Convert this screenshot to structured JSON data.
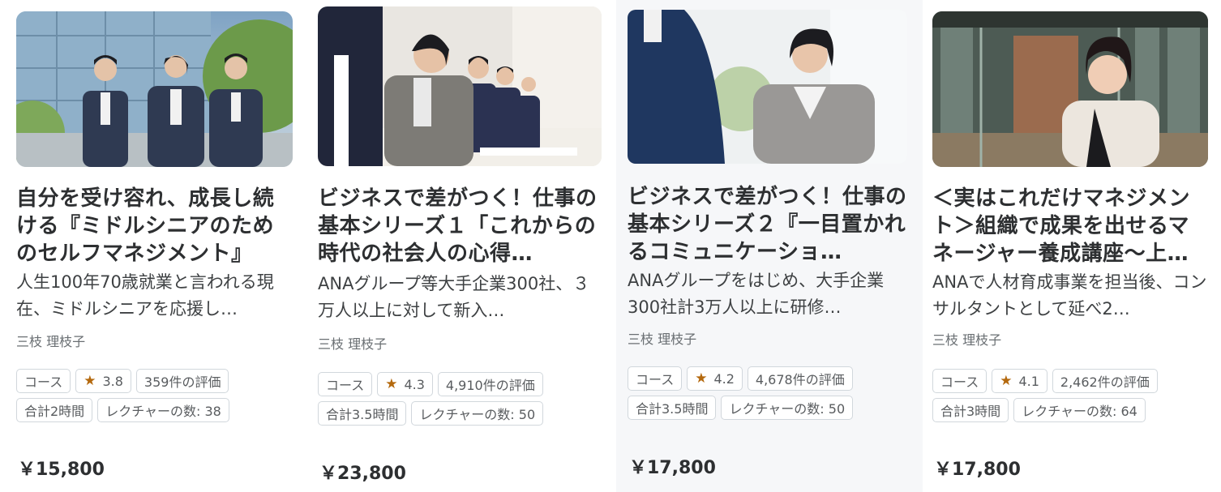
{
  "courses": [
    {
      "title": "自分を受け容れ、成長し続ける『ミドルシニアのためのセルフマネジメント』",
      "description": "人生100年70歳就業と言われる現在、ミドルシニアを応援し…",
      "instructor": "三枝 理枝子",
      "type_badge": "コース",
      "rating": "3.8",
      "reviews": "359件の評価",
      "hours": "合計2時間",
      "lectures": "レクチャーの数: 38",
      "price": "￥15,800"
    },
    {
      "title": "ビジネスで差がつく！仕事の基本シリーズ１「これからの時代の社会人の心得…",
      "description": "ANAグループ等大手企業300社、３万人以上に対して新入…",
      "instructor": "三枝 理枝子",
      "type_badge": "コース",
      "rating": "4.3",
      "reviews": "4,910件の評価",
      "hours": "合計3.5時間",
      "lectures": "レクチャーの数: 50",
      "price": "￥23,800"
    },
    {
      "title": "ビジネスで差がつく！仕事の基本シリーズ２『一目置かれるコミュニケーショ…",
      "description": "ANAグループをはじめ、大手企業300社計3万人以上に研修…",
      "instructor": "三枝 理枝子",
      "type_badge": "コース",
      "rating": "4.2",
      "reviews": "4,678件の評価",
      "hours": "合計3.5時間",
      "lectures": "レクチャーの数: 50",
      "price": "￥17,800"
    },
    {
      "title": "＜実はこれだけマネジメント＞組織で成果を出せるマネージャー養成講座〜上…",
      "description": "ANAで人材育成事業を担当後、コンサルタントとして延べ2…",
      "instructor": "三枝 理枝子",
      "type_badge": "コース",
      "rating": "4.1",
      "reviews": "2,462件の評価",
      "hours": "合計3時間",
      "lectures": "レクチャーの数: 64",
      "price": "￥17,800"
    }
  ],
  "colors": {
    "star": "#b4690e",
    "badge_border": "#d1d7dc",
    "hover_bg": "#f6f7f9",
    "text": "#2d2f31"
  },
  "icons": {
    "rating": "star-icon"
  }
}
